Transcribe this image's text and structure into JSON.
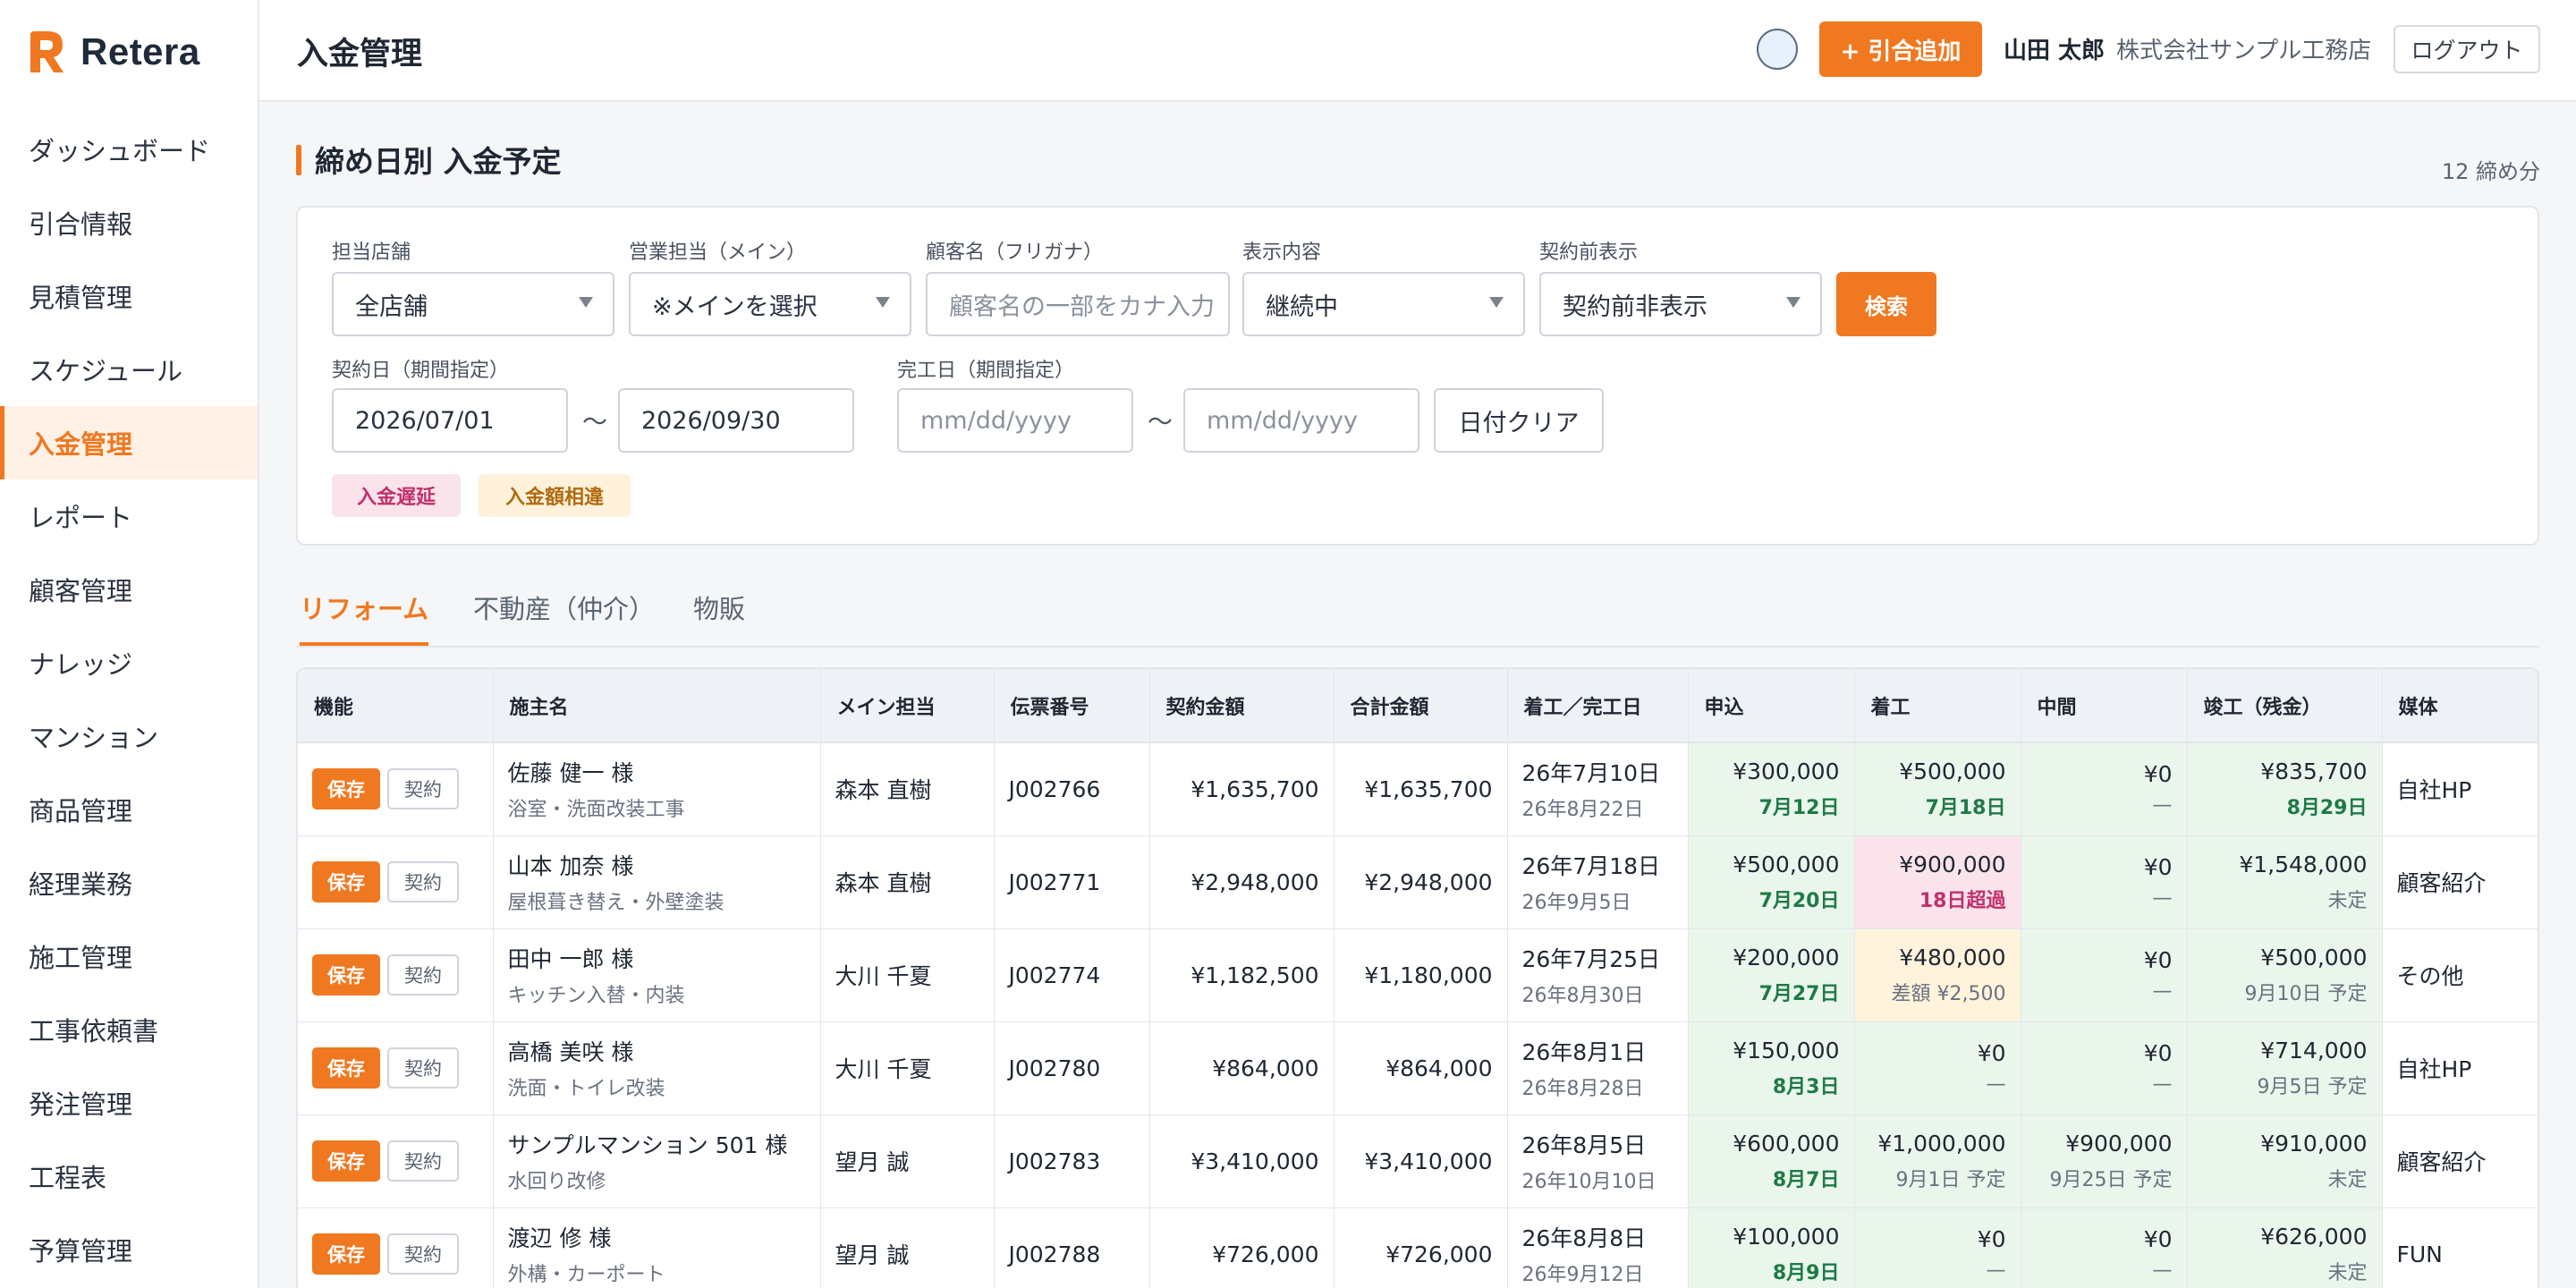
{
  "app": {
    "name": "Retera",
    "brand_color": "#f07820"
  },
  "sidebar": {
    "items": [
      {
        "label": "ダッシュボード",
        "active": false
      },
      {
        "label": "引合情報",
        "active": false
      },
      {
        "label": "見積管理",
        "active": false
      },
      {
        "label": "スケジュール",
        "active": false
      },
      {
        "label": "入金管理",
        "active": true
      },
      {
        "label": "レポート",
        "active": false
      },
      {
        "label": "顧客管理",
        "active": false
      },
      {
        "label": "ナレッジ",
        "active": false
      },
      {
        "label": "マンション",
        "active": false
      },
      {
        "label": "商品管理",
        "active": false
      },
      {
        "label": "経理業務",
        "active": false
      },
      {
        "label": "施工管理",
        "active": false
      },
      {
        "label": "工事依頼書",
        "active": false
      },
      {
        "label": "発注管理",
        "active": false
      },
      {
        "label": "工程表",
        "active": false
      },
      {
        "label": "予算管理",
        "active": false
      }
    ]
  },
  "header": {
    "title": "入金管理",
    "add_button": "+ 引合追加",
    "user_name": "山田 太郎",
    "company": "株式会社サンプル工務店",
    "logout": "ログアウト"
  },
  "section": {
    "title": "締め日別 入金予定",
    "count": "12 締め分"
  },
  "filters": {
    "store": {
      "label": "担当店舗",
      "value": "全店舗"
    },
    "sales": {
      "label": "営業担当（メイン）",
      "value": "※メインを選択"
    },
    "customer": {
      "label": "顧客名（フリガナ）",
      "placeholder": "顧客名の一部をカナ入力"
    },
    "display": {
      "label": "表示内容",
      "value": "継続中"
    },
    "precontract": {
      "label": "契約前表示",
      "value": "契約前非表示"
    },
    "search_button": "検索",
    "contract_date": {
      "label": "契約日（期間指定）",
      "from": "2026/07/01",
      "to": "2026/09/30"
    },
    "complete_date": {
      "label": "完工日（期間指定）",
      "from_placeholder": "mm/dd/yyyy",
      "to_placeholder": "mm/dd/yyyy"
    },
    "tilde": "～",
    "clear_button": "日付クリア",
    "chips": {
      "delay": "入金遅延",
      "diff": "入金額相違"
    }
  },
  "tabs": [
    {
      "label": "リフォーム",
      "active": true
    },
    {
      "label": "不動産（仲介）",
      "active": false
    },
    {
      "label": "物販",
      "active": false
    }
  ],
  "table": {
    "headers": [
      "機能",
      "施主名",
      "メイン担当",
      "伝票番号",
      "契約金額",
      "合計金額",
      "着工／完工日",
      "申込",
      "着工",
      "中間",
      "竣工（残金）",
      "媒体"
    ],
    "save_label": "保存",
    "contract_label": "契約",
    "rows": [
      {
        "owner": "佐藤 健一 様",
        "work": "浴室・洗面改装工事",
        "rep": "森本 直樹",
        "slip": "J002766",
        "contract": "¥1,635,700",
        "total": "¥1,635,700",
        "start": "26年7月10日",
        "end": "26年8月22日",
        "p1": {
          "amt": "¥300,000",
          "sub": "7月12日",
          "kind": "ok",
          "bg": "green"
        },
        "p2": {
          "amt": "¥500,000",
          "sub": "7月18日",
          "kind": "ok",
          "bg": "green"
        },
        "p3": {
          "amt": "¥0",
          "sub": "—",
          "kind": "plain",
          "bg": "green"
        },
        "p4": {
          "amt": "¥835,700",
          "sub": "8月29日",
          "kind": "ok",
          "bg": "green"
        },
        "media": "自社HP"
      },
      {
        "owner": "山本 加奈 様",
        "work": "屋根葺き替え・外壁塗装",
        "rep": "森本 直樹",
        "slip": "J002771",
        "contract": "¥2,948,000",
        "total": "¥2,948,000",
        "start": "26年7月18日",
        "end": "26年9月5日",
        "p1": {
          "amt": "¥500,000",
          "sub": "7月20日",
          "kind": "ok",
          "bg": "green"
        },
        "p2": {
          "amt": "¥900,000",
          "sub": "18日超過",
          "kind": "late",
          "bg": "pink"
        },
        "p3": {
          "amt": "¥0",
          "sub": "—",
          "kind": "plain",
          "bg": "green"
        },
        "p4": {
          "amt": "¥1,548,000",
          "sub": "未定",
          "kind": "plain",
          "bg": "green"
        },
        "media": "顧客紹介"
      },
      {
        "owner": "田中 一郎 様",
        "work": "キッチン入替・内装",
        "rep": "大川 千夏",
        "slip": "J002774",
        "contract": "¥1,182,500",
        "total": "¥1,180,000",
        "start": "26年7月25日",
        "end": "26年8月30日",
        "p1": {
          "amt": "¥200,000",
          "sub": "7月27日",
          "kind": "ok",
          "bg": "green"
        },
        "p2": {
          "amt": "¥480,000",
          "sub": "差額 ¥2,500",
          "kind": "plain",
          "bg": "yellow"
        },
        "p3": {
          "amt": "¥0",
          "sub": "—",
          "kind": "plain",
          "bg": "green"
        },
        "p4": {
          "amt": "¥500,000",
          "sub": "9月10日 予定",
          "kind": "plain",
          "bg": "green"
        },
        "media": "その他"
      },
      {
        "owner": "高橋 美咲 様",
        "work": "洗面・トイレ改装",
        "rep": "大川 千夏",
        "slip": "J002780",
        "contract": "¥864,000",
        "total": "¥864,000",
        "start": "26年8月1日",
        "end": "26年8月28日",
        "p1": {
          "amt": "¥150,000",
          "sub": "8月3日",
          "kind": "ok",
          "bg": "green"
        },
        "p2": {
          "amt": "¥0",
          "sub": "—",
          "kind": "plain",
          "bg": "green"
        },
        "p3": {
          "amt": "¥0",
          "sub": "—",
          "kind": "plain",
          "bg": "green"
        },
        "p4": {
          "amt": "¥714,000",
          "sub": "9月5日 予定",
          "kind": "plain",
          "bg": "green"
        },
        "media": "自社HP"
      },
      {
        "owner": "サンプルマンション 501 様",
        "work": "水回り改修",
        "rep": "望月 誠",
        "slip": "J002783",
        "contract": "¥3,410,000",
        "total": "¥3,410,000",
        "start": "26年8月5日",
        "end": "26年10月10日",
        "p1": {
          "amt": "¥600,000",
          "sub": "8月7日",
          "kind": "ok",
          "bg": "green"
        },
        "p2": {
          "amt": "¥1,000,000",
          "sub": "9月1日 予定",
          "kind": "plain",
          "bg": "green"
        },
        "p3": {
          "amt": "¥900,000",
          "sub": "9月25日 予定",
          "kind": "plain",
          "bg": "green"
        },
        "p4": {
          "amt": "¥910,000",
          "sub": "未定",
          "kind": "plain",
          "bg": "green"
        },
        "media": "顧客紹介"
      },
      {
        "owner": "渡辺 修 様",
        "work": "外構・カーポート",
        "rep": "望月 誠",
        "slip": "J002788",
        "contract": "¥726,000",
        "total": "¥726,000",
        "start": "26年8月8日",
        "end": "26年9月12日",
        "p1": {
          "amt": "¥100,000",
          "sub": "8月9日",
          "kind": "ok",
          "bg": "green"
        },
        "p2": {
          "amt": "¥0",
          "sub": "—",
          "kind": "plain",
          "bg": "green"
        },
        "p3": {
          "amt": "¥0",
          "sub": "—",
          "kind": "plain",
          "bg": "green"
        },
        "p4": {
          "amt": "¥626,000",
          "sub": "未定",
          "kind": "plain",
          "bg": "green"
        },
        "media": "FUN"
      }
    ]
  }
}
